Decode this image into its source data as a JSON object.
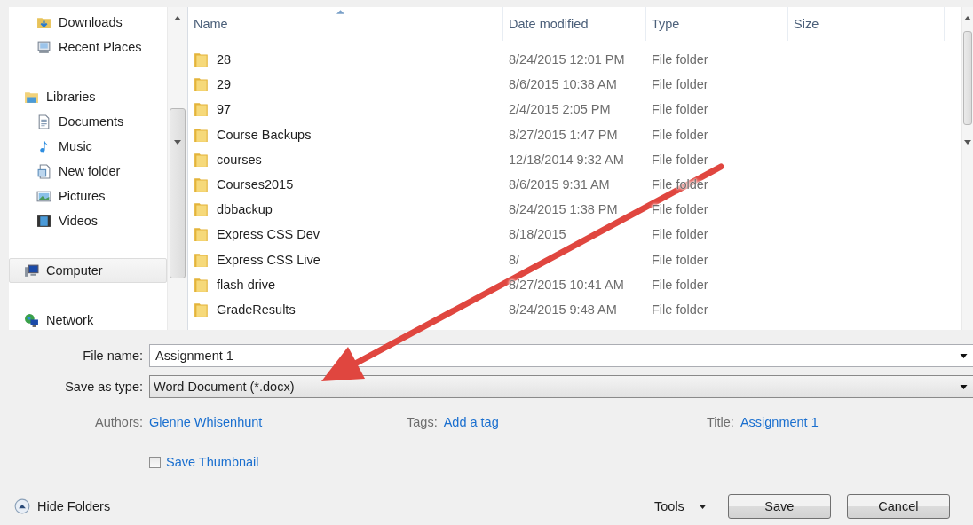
{
  "nav": {
    "items": [
      {
        "label": "Downloads",
        "kind": "item",
        "selected": false
      },
      {
        "label": "Recent Places",
        "kind": "item",
        "selected": false
      },
      {
        "label": "Libraries",
        "kind": "group",
        "selected": false
      },
      {
        "label": "Documents",
        "kind": "item",
        "selected": false
      },
      {
        "label": "Music",
        "kind": "item",
        "selected": false
      },
      {
        "label": "New folder",
        "kind": "item",
        "selected": false
      },
      {
        "label": "Pictures",
        "kind": "item",
        "selected": false
      },
      {
        "label": "Videos",
        "kind": "item",
        "selected": false
      },
      {
        "label": "Computer",
        "kind": "group",
        "selected": true
      },
      {
        "label": "Network",
        "kind": "group",
        "selected": false
      }
    ]
  },
  "file_list": {
    "columns": [
      {
        "label": "Name",
        "sorted": true
      },
      {
        "label": "Date modified",
        "sorted": false
      },
      {
        "label": "Type",
        "sorted": false
      },
      {
        "label": "Size",
        "sorted": false
      }
    ],
    "rows": [
      {
        "name": "28",
        "date": "8/24/2015 12:01 PM",
        "type": "File folder"
      },
      {
        "name": "29",
        "date": "8/6/2015 10:38 AM",
        "type": "File folder"
      },
      {
        "name": "97",
        "date": "2/4/2015 2:05 PM",
        "type": "File folder"
      },
      {
        "name": "Course Backups",
        "date": "8/27/2015 1:47 PM",
        "type": "File folder"
      },
      {
        "name": "courses",
        "date": "12/18/2014 9:32 AM",
        "type": "File folder"
      },
      {
        "name": "Courses2015",
        "date": "8/6/2015 9:31 AM",
        "type": "File folder"
      },
      {
        "name": "dbbackup",
        "date": "8/24/2015 1:38 PM",
        "type": "File folder"
      },
      {
        "name": "Express CSS Dev",
        "date": "8/18/2015",
        "type": "File folder"
      },
      {
        "name": "Express CSS Live",
        "date": "8/",
        "type": "File folder"
      },
      {
        "name": "flash drive",
        "date": "8/27/2015 10:41 AM",
        "type": "File folder"
      },
      {
        "name": "GradeResults",
        "date": "8/24/2015 9:48 AM",
        "type": "File folder"
      }
    ]
  },
  "form": {
    "file_name": {
      "label": "File name:",
      "value": "Assignment 1"
    },
    "save_as_type": {
      "label": "Save as type:",
      "value": "Word Document (*.docx)"
    }
  },
  "metadata": [
    {
      "label": "Authors:",
      "value": "Glenne Whisenhunt"
    },
    {
      "label": "Tags:",
      "value": "Add a tag"
    },
    {
      "label": "Title:",
      "value": "Assignment 1"
    }
  ],
  "save_thumbnail": {
    "label": "Save Thumbnail",
    "checked": false
  },
  "hide_folders": "Hide Folders",
  "tools": "Tools",
  "buttons": [
    "Save",
    "Cancel"
  ]
}
